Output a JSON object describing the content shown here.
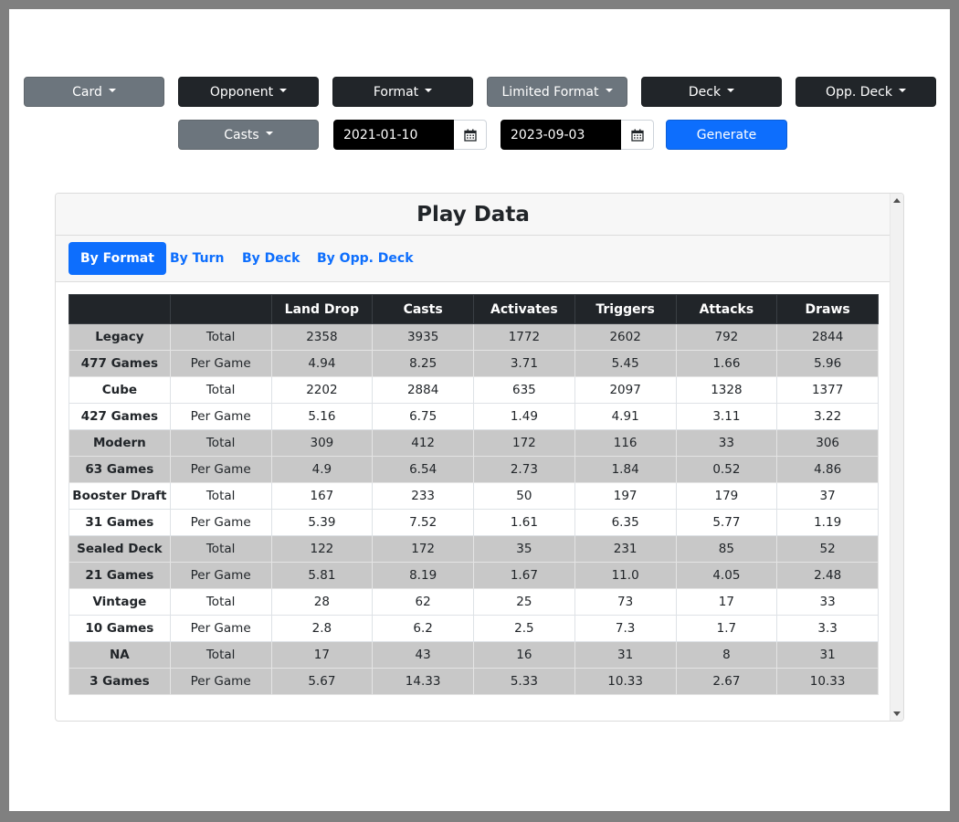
{
  "filters": {
    "row1": [
      {
        "label": "Card",
        "style": "grey"
      },
      {
        "label": "Opponent",
        "style": "dark"
      },
      {
        "label": "Format",
        "style": "dark"
      },
      {
        "label": "Limited Format",
        "style": "grey"
      },
      {
        "label": "Deck",
        "style": "dark"
      },
      {
        "label": "Opp. Deck",
        "style": "dark"
      }
    ],
    "casts_label": "Casts",
    "start_date": "2021-01-10",
    "end_date": "2023-09-03",
    "generate_label": "Generate"
  },
  "card": {
    "title": "Play Data",
    "tabs": [
      {
        "label": "By Format",
        "active": true
      },
      {
        "label": "By Turn",
        "active": false
      },
      {
        "label": "By Deck",
        "active": false
      },
      {
        "label": "By Opp. Deck",
        "active": false
      }
    ]
  },
  "table": {
    "columns": [
      "",
      "",
      "Land Drop",
      "Casts",
      "Activates",
      "Triggers",
      "Attacks",
      "Draws"
    ],
    "rows": [
      {
        "head": "Legacy",
        "type": "Total",
        "values": [
          "2358",
          "3935",
          "1772",
          "2602",
          "792",
          "2844"
        ],
        "shade": true
      },
      {
        "head": "477 Games",
        "type": "Per Game",
        "values": [
          "4.94",
          "8.25",
          "3.71",
          "5.45",
          "1.66",
          "5.96"
        ],
        "shade": true
      },
      {
        "head": "Cube",
        "type": "Total",
        "values": [
          "2202",
          "2884",
          "635",
          "2097",
          "1328",
          "1377"
        ],
        "shade": false
      },
      {
        "head": "427 Games",
        "type": "Per Game",
        "values": [
          "5.16",
          "6.75",
          "1.49",
          "4.91",
          "3.11",
          "3.22"
        ],
        "shade": false
      },
      {
        "head": "Modern",
        "type": "Total",
        "values": [
          "309",
          "412",
          "172",
          "116",
          "33",
          "306"
        ],
        "shade": true
      },
      {
        "head": "63 Games",
        "type": "Per Game",
        "values": [
          "4.9",
          "6.54",
          "2.73",
          "1.84",
          "0.52",
          "4.86"
        ],
        "shade": true
      },
      {
        "head": "Booster Draft",
        "type": "Total",
        "values": [
          "167",
          "233",
          "50",
          "197",
          "179",
          "37"
        ],
        "shade": false
      },
      {
        "head": "31 Games",
        "type": "Per Game",
        "values": [
          "5.39",
          "7.52",
          "1.61",
          "6.35",
          "5.77",
          "1.19"
        ],
        "shade": false
      },
      {
        "head": "Sealed Deck",
        "type": "Total",
        "values": [
          "122",
          "172",
          "35",
          "231",
          "85",
          "52"
        ],
        "shade": true
      },
      {
        "head": "21 Games",
        "type": "Per Game",
        "values": [
          "5.81",
          "8.19",
          "1.67",
          "11.0",
          "4.05",
          "2.48"
        ],
        "shade": true
      },
      {
        "head": "Vintage",
        "type": "Total",
        "values": [
          "28",
          "62",
          "25",
          "73",
          "17",
          "33"
        ],
        "shade": false
      },
      {
        "head": "10 Games",
        "type": "Per Game",
        "values": [
          "2.8",
          "6.2",
          "2.5",
          "7.3",
          "1.7",
          "3.3"
        ],
        "shade": false
      },
      {
        "head": "NA",
        "type": "Total",
        "values": [
          "17",
          "43",
          "16",
          "31",
          "8",
          "31"
        ],
        "shade": true
      },
      {
        "head": "3 Games",
        "type": "Per Game",
        "values": [
          "5.67",
          "14.33",
          "5.33",
          "10.33",
          "2.67",
          "10.33"
        ],
        "shade": true
      }
    ]
  },
  "icons": {
    "calendar": "calendar-icon",
    "caret": "caret-down-icon",
    "scroll_up": "scroll-up-icon",
    "scroll_down": "scroll-down-icon"
  }
}
